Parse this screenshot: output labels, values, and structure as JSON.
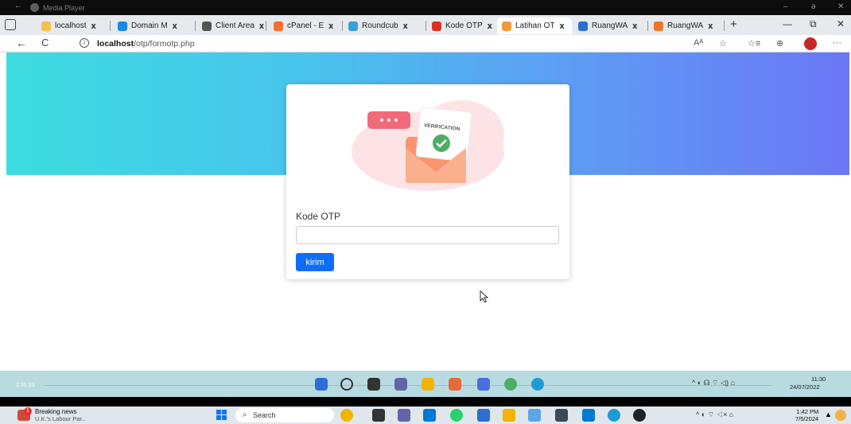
{
  "media_player": {
    "title": "Media Player",
    "back": "←",
    "minimize": "–",
    "restore": "ə",
    "close": "✕"
  },
  "tabs": [
    {
      "label": "localhost",
      "favicon_color": "#f6c04b"
    },
    {
      "label": "Domain M",
      "favicon_color": "#1e88e5"
    },
    {
      "label": "Client Area",
      "favicon_color": "#555555"
    },
    {
      "label": "cPanel - E",
      "favicon_color": "#ff6c2c"
    },
    {
      "label": "Roundcub",
      "favicon_color": "#37a0da"
    },
    {
      "label": "Kode OTP",
      "favicon_color": "#d93025"
    },
    {
      "label": "Latihan OT",
      "favicon_color": "#f29a3a",
      "active": true
    },
    {
      "label": "RuangWA",
      "favicon_color": "#2b6fd6"
    },
    {
      "label": "RuangWA",
      "favicon_color": "#f0742a"
    }
  ],
  "tab_close": "x",
  "new_tab": "+",
  "window": {
    "minimize": "—",
    "restore": "⧉",
    "close": "✕"
  },
  "address_bar": {
    "back": "←",
    "reload": "C",
    "info": "i",
    "url_host": "localhost",
    "url_path": "/otp/formotp.php",
    "read_aloud": "Aᴬ",
    "favorite": "☆",
    "favorites": "☆≡",
    "collections": "⊕",
    "more": "···"
  },
  "form": {
    "illustration_text": "VERIFICATION",
    "label": "Kode OTP",
    "input_value": "",
    "submit_label": "kirim"
  },
  "taskbar_inner": {
    "elapsed": "2:31:23",
    "tray": "^ ◐ ☊  ⌔ ◁) ⌂",
    "time": "11:30",
    "date": "24/07/2022"
  },
  "taskbar_outer": {
    "news_badge": "1",
    "news_title": "Breaking news",
    "news_subtitle": "U.K.'s Labour Par...",
    "search_placeholder": "Search",
    "tray": "^  ◐  ⌔ ◁× ⌂",
    "time": "1:42 PM",
    "date": "7/5/2024",
    "bell": "▲"
  },
  "colors": {
    "hero_start": "#3ddde0",
    "hero_end": "#6a77f6",
    "button": "#0d6efd"
  }
}
